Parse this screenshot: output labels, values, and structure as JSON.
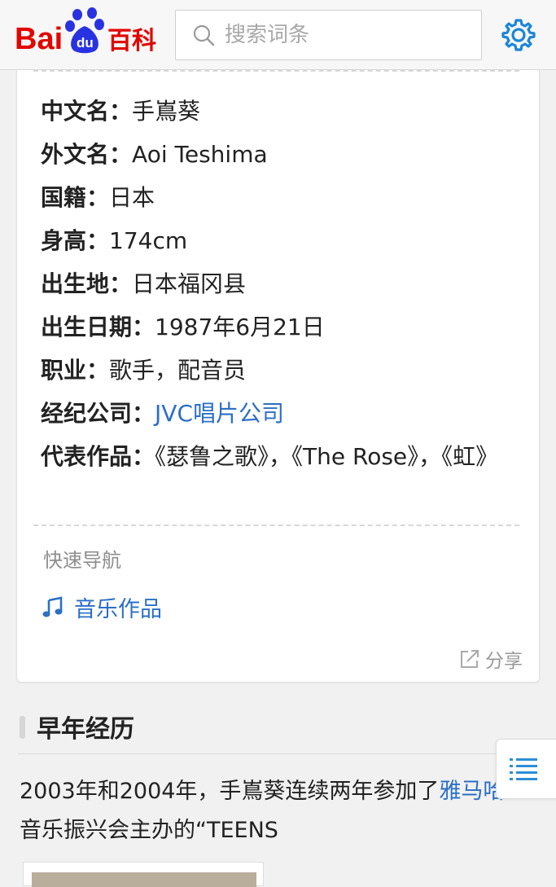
{
  "header": {
    "logo_text": "Bai du 百科",
    "search_placeholder": "搜索词条"
  },
  "infobox": {
    "rows": [
      {
        "key": "中文名",
        "sep": "：",
        "value": "手嶌葵"
      },
      {
        "key": "外文名",
        "sep": "：",
        "value": "Aoi Teshima"
      },
      {
        "key": "国籍",
        "sep": "：",
        "value": "日本"
      },
      {
        "key": "身高",
        "sep": "：",
        "value": "174cm"
      },
      {
        "key": "出生地",
        "sep": "：",
        "value": "日本福冈县"
      },
      {
        "key": "出生日期",
        "sep": "：",
        "value": "1987年6月21日"
      },
      {
        "key": "职业",
        "sep": "：",
        "value": "歌手，配音员"
      },
      {
        "key": "经纪公司",
        "sep": "：",
        "value": "JVC唱片公司"
      },
      {
        "key": "代表作品",
        "sep": "：",
        "value": "《瑟鲁之歌》，《The Rose》，《虹》"
      }
    ]
  },
  "quick_nav": {
    "title": "快速导航",
    "item_label": "音乐作品",
    "share_label": "分享"
  },
  "section": {
    "title": "早年经历",
    "para_before": "2003年和2004年，手嶌葵连续两年参加了",
    "para_link": "雅马哈",
    "para_after": "音乐振兴会主办的“TEENS"
  },
  "colors": {
    "link": "#2b6fc6",
    "brand_red": "#e10601",
    "brand_blue": "#2932e1",
    "settings_blue": "#1a86d8"
  },
  "icons": {
    "search": "search-icon",
    "settings": "gear-icon",
    "music": "music-note-icon",
    "share": "share-icon",
    "toc": "list-icon"
  }
}
